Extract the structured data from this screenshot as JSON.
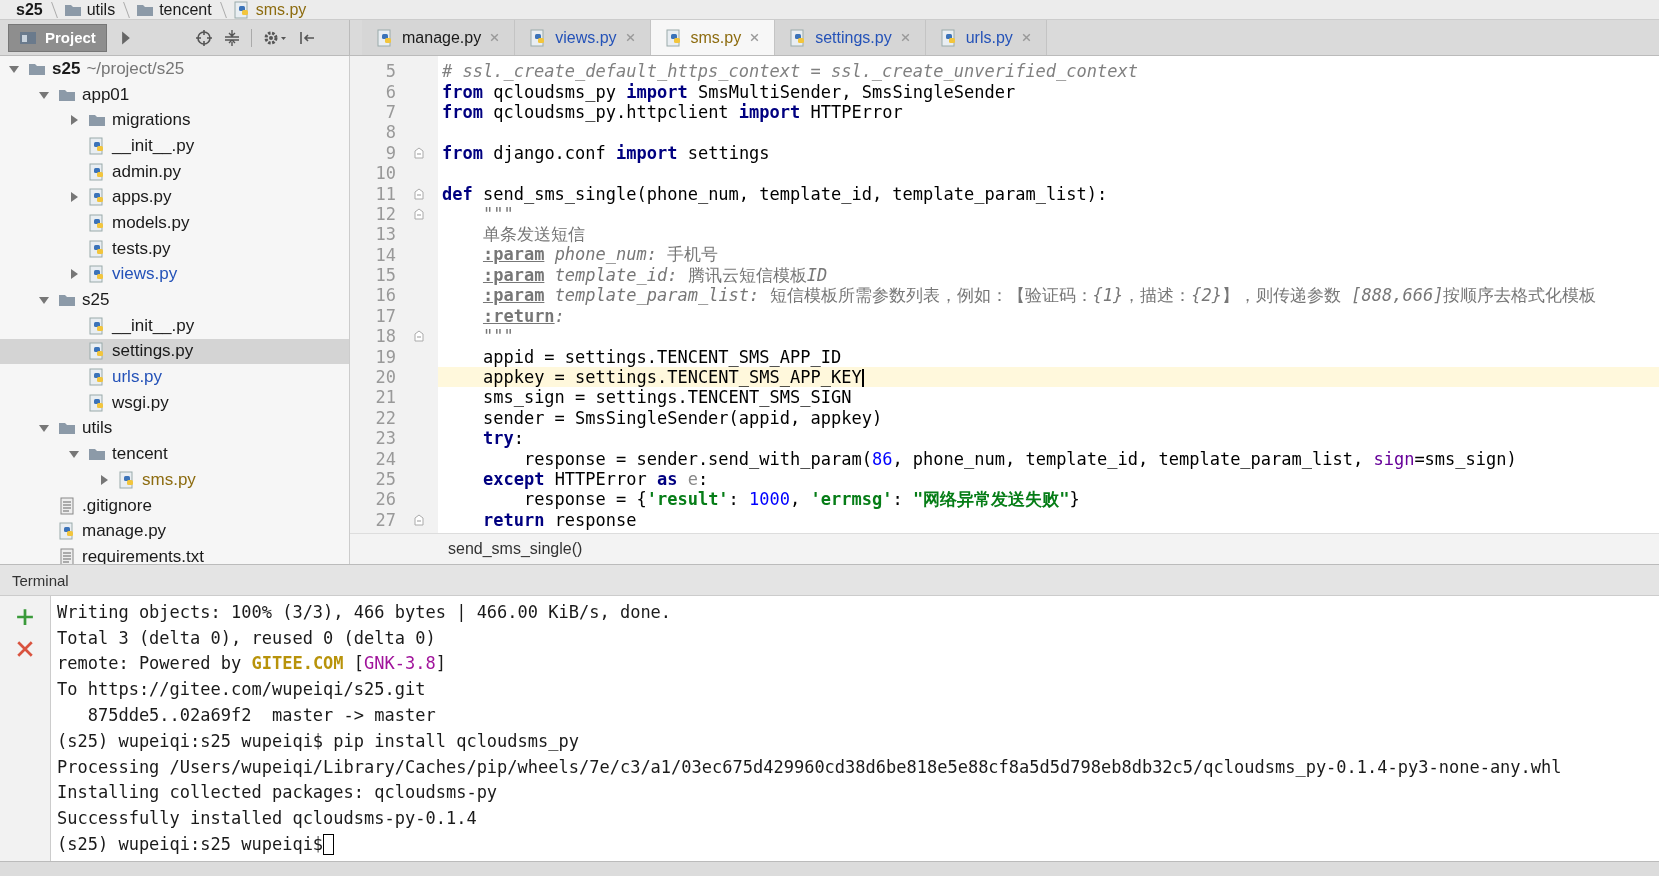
{
  "breadcrumbs": [
    {
      "label": "s25",
      "kind": "module",
      "color": "#1a1a1a"
    },
    {
      "label": "utils",
      "kind": "folder",
      "color": "#1a1a1a"
    },
    {
      "label": "tencent",
      "kind": "folder",
      "color": "#1a1a1a"
    },
    {
      "label": "sms.py",
      "kind": "python",
      "color": "#8d6c10"
    }
  ],
  "tool_window": {
    "label": "Project"
  },
  "tabs": [
    {
      "label": "manage.py",
      "color": "#1a1a1a",
      "selected": false
    },
    {
      "label": "views.py",
      "color": "#2452b8",
      "selected": false
    },
    {
      "label": "sms.py",
      "color": "#8d6c10",
      "selected": true
    },
    {
      "label": "settings.py",
      "color": "#2452b8",
      "selected": false
    },
    {
      "label": "urls.py",
      "color": "#2452b8",
      "selected": false
    }
  ],
  "tree": [
    {
      "label": "s25",
      "path": "~/project/s25",
      "kind": "folder",
      "color": "#1a1a1a",
      "expanded": true,
      "selected": false,
      "children": [
        {
          "label": "app01",
          "kind": "folder",
          "color": "#1a1a1a",
          "expanded": true,
          "selected": false,
          "children": [
            {
              "label": "migrations",
              "kind": "folder",
              "color": "#1a1a1a",
              "expanded": false,
              "selected": false
            },
            {
              "label": "__init__.py",
              "kind": "python",
              "color": "#1a1a1a",
              "selected": false
            },
            {
              "label": "admin.py",
              "kind": "python",
              "color": "#1a1a1a",
              "selected": false
            },
            {
              "label": "apps.py",
              "kind": "python",
              "color": "#1a1a1a",
              "expanded": false,
              "selected": false
            },
            {
              "label": "models.py",
              "kind": "python",
              "color": "#1a1a1a",
              "selected": false
            },
            {
              "label": "tests.py",
              "kind": "python",
              "color": "#1a1a1a",
              "selected": false
            },
            {
              "label": "views.py",
              "kind": "python",
              "color": "#2452b8",
              "expanded": false,
              "selected": false
            }
          ]
        },
        {
          "label": "s25",
          "kind": "folder",
          "color": "#1a1a1a",
          "expanded": true,
          "selected": false,
          "children": [
            {
              "label": "__init__.py",
              "kind": "python",
              "color": "#1a1a1a",
              "selected": false
            },
            {
              "label": "settings.py",
              "kind": "python",
              "color": "#1a1a1a",
              "selected": true
            },
            {
              "label": "urls.py",
              "kind": "python",
              "color": "#2452b8",
              "selected": false
            },
            {
              "label": "wsgi.py",
              "kind": "python",
              "color": "#1a1a1a",
              "selected": false
            }
          ]
        },
        {
          "label": "utils",
          "kind": "folder",
          "color": "#1a1a1a",
          "expanded": true,
          "selected": false,
          "children": [
            {
              "label": "tencent",
              "kind": "folder",
              "color": "#1a1a1a",
              "expanded": true,
              "selected": false,
              "children": [
                {
                  "label": "sms.py",
                  "kind": "python",
                  "color": "#8d6c10",
                  "expanded": false,
                  "selected": false
                }
              ]
            }
          ]
        },
        {
          "label": ".gitignore",
          "kind": "text",
          "color": "#1a1a1a",
          "selected": false
        },
        {
          "label": "manage.py",
          "kind": "python",
          "color": "#1a1a1a",
          "selected": false
        },
        {
          "label": "requirements.txt",
          "kind": "text",
          "color": "#1a1a1a",
          "selected": false
        }
      ]
    }
  ],
  "editor": {
    "lines": [
      {
        "no": "5",
        "tokens": [
          {
            "text": "# ssl._create_default_https_context = ssl._create_unverified_context",
            "kind": "comment"
          }
        ]
      },
      {
        "no": "6",
        "tokens": [
          {
            "text": "from",
            "kind": "kw"
          },
          {
            "text": " qcloudsms_py ",
            "kind": "plain"
          },
          {
            "text": "import",
            "kind": "kw"
          },
          {
            "text": " SmsMultiSender, SmsSingleSender",
            "kind": "plain"
          }
        ]
      },
      {
        "no": "7",
        "tokens": [
          {
            "text": "from",
            "kind": "kw"
          },
          {
            "text": " qcloudsms_py.httpclient ",
            "kind": "plain"
          },
          {
            "text": "import",
            "kind": "kw"
          },
          {
            "text": " HTTPError",
            "kind": "plain"
          }
        ]
      },
      {
        "no": "8"
      },
      {
        "no": "9",
        "fold": true,
        "tokens": [
          {
            "text": "from",
            "kind": "kw"
          },
          {
            "text": " django.conf ",
            "kind": "plain"
          },
          {
            "text": "import",
            "kind": "kw"
          },
          {
            "text": " settings",
            "kind": "plain"
          }
        ]
      },
      {
        "no": "10"
      },
      {
        "no": "11",
        "fold": true,
        "tokens": [
          {
            "text": "def",
            "kind": "kw"
          },
          {
            "text": " send_sms_single(phone_num, template_id, template_param_list):",
            "kind": "plain"
          }
        ]
      },
      {
        "no": "12",
        "fold": true,
        "tokens": [
          {
            "text": "    \"\"\"",
            "kind": "doc"
          }
        ]
      },
      {
        "no": "13",
        "tokens": [
          {
            "text": "    单条发送短信",
            "kind": "doc"
          }
        ]
      },
      {
        "no": "14",
        "tokens": [
          {
            "text": "    :param",
            "kind": "doctag"
          },
          {
            "text": " phone_num:",
            "kind": "docparam"
          },
          {
            "text": " 手机号",
            "kind": "doc"
          }
        ]
      },
      {
        "no": "15",
        "tokens": [
          {
            "text": "    :param",
            "kind": "doctag"
          },
          {
            "text": " template_id:",
            "kind": "docparam"
          },
          {
            "text": " 腾讯云短信模板",
            "kind": "doc"
          },
          {
            "text": "ID",
            "kind": "docparam"
          }
        ]
      },
      {
        "no": "16",
        "tokens": [
          {
            "text": "    :param",
            "kind": "doctag"
          },
          {
            "text": " template_param_list:",
            "kind": "docparam"
          },
          {
            "text": " 短信模板所需参数列表，例如：【验证码：",
            "kind": "doc"
          },
          {
            "text": "{1}",
            "kind": "docparam"
          },
          {
            "text": "，描述：",
            "kind": "doc"
          },
          {
            "text": "{2}",
            "kind": "docparam"
          },
          {
            "text": "】，则传递参数 ",
            "kind": "doc"
          },
          {
            "text": "[888,666]",
            "kind": "docparam"
          },
          {
            "text": "按顺序去格式化模板",
            "kind": "doc"
          }
        ]
      },
      {
        "no": "17",
        "tokens": [
          {
            "text": "    :return",
            "kind": "doctag"
          },
          {
            "text": ":",
            "kind": "docparam"
          }
        ]
      },
      {
        "no": "18",
        "fold": true,
        "tokens": [
          {
            "text": "    \"\"\"",
            "kind": "doc"
          }
        ]
      },
      {
        "no": "19",
        "tokens": [
          {
            "text": "    appid = settings.TENCENT_SMS_APP_ID",
            "kind": "plain"
          }
        ]
      },
      {
        "no": "20",
        "current": true,
        "tokens": [
          {
            "text": "    appkey = settings.TENCENT_SMS_APP_KEY",
            "kind": "plain"
          }
        ]
      },
      {
        "no": "21",
        "tokens": [
          {
            "text": "    sms_sign = settings.TENCENT_SMS_SIGN",
            "kind": "plain"
          }
        ]
      },
      {
        "no": "22",
        "tokens": [
          {
            "text": "    sender = SmsSingleSender(appid, appkey)",
            "kind": "plain"
          }
        ]
      },
      {
        "no": "23",
        "tokens": [
          {
            "text": "    try",
            "kind": "kw"
          },
          {
            "text": ":",
            "kind": "plain"
          }
        ]
      },
      {
        "no": "24",
        "tokens": [
          {
            "text": "        response = sender.send_with_param(",
            "kind": "plain"
          },
          {
            "text": "86",
            "kind": "num"
          },
          {
            "text": ", phone_num, template_id, template_param_list, ",
            "kind": "plain"
          },
          {
            "text": "sign",
            "kind": "kwarg"
          },
          {
            "text": "=sms_sign)",
            "kind": "plain"
          }
        ]
      },
      {
        "no": "25",
        "tokens": [
          {
            "text": "    except",
            "kind": "kw"
          },
          {
            "text": " HTTPError ",
            "kind": "plain"
          },
          {
            "text": "as",
            "kind": "kw"
          },
          {
            "text": " e",
            "kind": "muted"
          },
          {
            "text": ":",
            "kind": "plain"
          }
        ]
      },
      {
        "no": "26",
        "tokens": [
          {
            "text": "        response = {",
            "kind": "plain"
          },
          {
            "text": "'result'",
            "kind": "str"
          },
          {
            "text": ": ",
            "kind": "plain"
          },
          {
            "text": "1000",
            "kind": "num"
          },
          {
            "text": ", ",
            "kind": "plain"
          },
          {
            "text": "'errmsg'",
            "kind": "str"
          },
          {
            "text": ": ",
            "kind": "plain"
          },
          {
            "text": "\"网络异常发送失败\"",
            "kind": "str"
          },
          {
            "text": "}",
            "kind": "plain"
          }
        ]
      },
      {
        "no": "27",
        "fold": true,
        "tokens": [
          {
            "text": "    return",
            "kind": "kw"
          },
          {
            "text": " response",
            "kind": "plain"
          }
        ]
      }
    ],
    "breadcrumb": "send_sms_single()"
  },
  "terminal": {
    "title": "Terminal",
    "lines": [
      {
        "tokens": [
          {
            "text": "Writing objects: 100% (3/3), 466 bytes | 466.00 KiB/s, done.",
            "kind": "plain"
          }
        ]
      },
      {
        "tokens": [
          {
            "text": "Total 3 (delta 0), reused 0 (delta 0)",
            "kind": "plain"
          }
        ]
      },
      {
        "tokens": [
          {
            "text": "remote: Powered by ",
            "kind": "plain"
          },
          {
            "text": "GITEE.COM",
            "kind": "gold"
          },
          {
            "text": " [",
            "kind": "plain"
          },
          {
            "text": "GNK-3.8",
            "kind": "magenta"
          },
          {
            "text": "]",
            "kind": "plain"
          }
        ]
      },
      {
        "tokens": [
          {
            "text": "To https://gitee.com/wupeiqi/s25.git",
            "kind": "plain"
          }
        ]
      },
      {
        "tokens": [
          {
            "text": "   875dde5..02a69f2  master -> master",
            "kind": "plain"
          }
        ]
      },
      {
        "tokens": [
          {
            "text": "(s25) wupeiqi:s25 wupeiqi$ pip install qcloudsms_py",
            "kind": "plain"
          }
        ]
      },
      {
        "tokens": [
          {
            "text": "Processing /Users/wupeiqi/Library/Caches/pip/wheels/7e/c3/a1/03ec675d429960cd38d6be818e5e88cf8a5d5d798eb8db32c5/qcloudsms_py-0.1.4-py3-none-any.whl",
            "kind": "plain"
          }
        ]
      },
      {
        "tokens": [
          {
            "text": "Installing collected packages: qcloudsms-py",
            "kind": "plain"
          }
        ]
      },
      {
        "tokens": [
          {
            "text": "Successfully installed qcloudsms-py-0.1.4",
            "kind": "plain"
          }
        ]
      },
      {
        "cursor": true,
        "tokens": [
          {
            "text": "(s25) wupeiqi:s25 wupeiqi$",
            "kind": "plain"
          }
        ]
      }
    ]
  }
}
